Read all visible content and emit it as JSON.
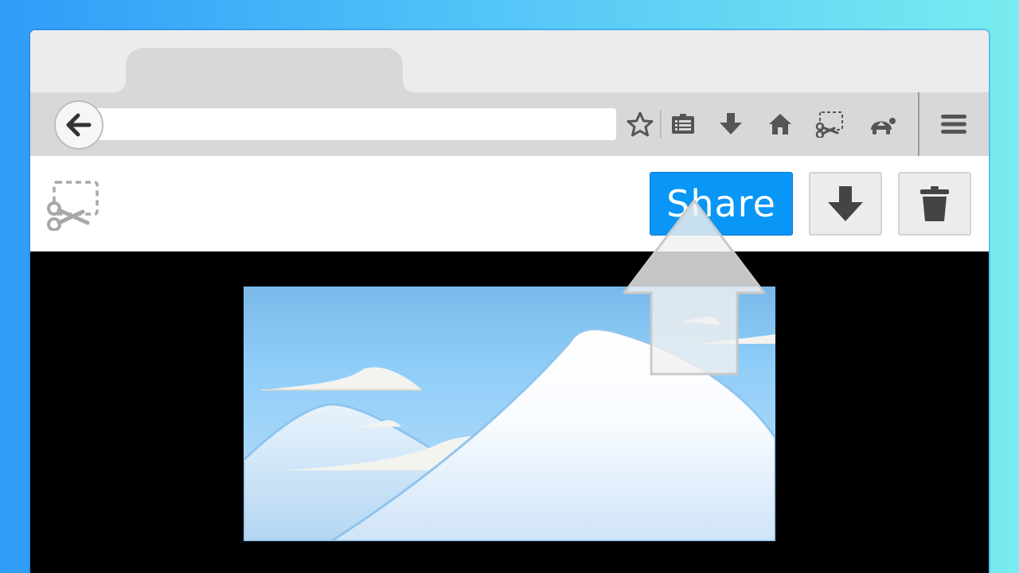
{
  "toolbar": {
    "share_label": "Share"
  },
  "icons": {
    "back": "back-arrow-icon",
    "bookmark": "star-icon",
    "reading_list": "reading-list-icon",
    "download": "download-arrow-icon",
    "home": "home-icon",
    "screenshot": "screenshot-scissors-icon",
    "extension": "turtle-icon",
    "menu": "hamburger-menu-icon",
    "save": "download-arrow-icon",
    "delete": "trash-icon",
    "pointer": "up-arrow-pointer-icon"
  },
  "colors": {
    "share_button": "#0a96f6",
    "icon": "#555555",
    "sky_top": "#7ab8ea",
    "sky_bottom": "#bfe0fb"
  }
}
